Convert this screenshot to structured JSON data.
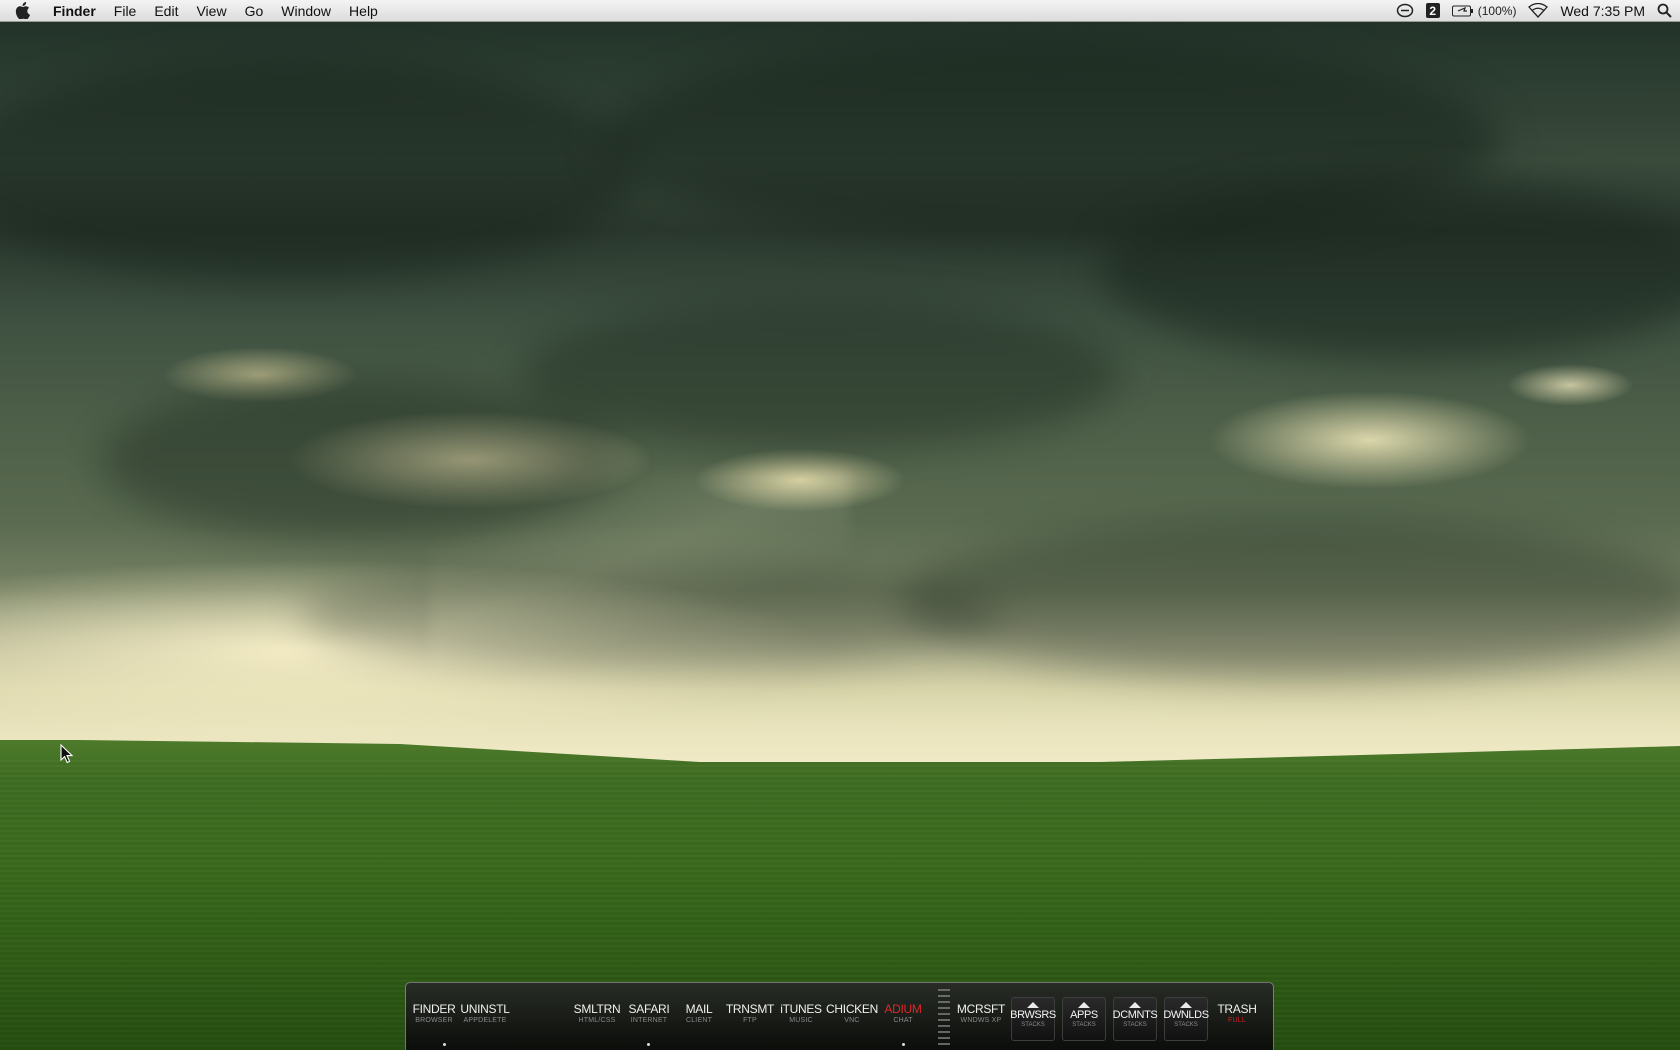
{
  "menubar": {
    "apple_icon": "apple-logo-icon",
    "app_name": "Finder",
    "menus": [
      "File",
      "Edit",
      "View",
      "Go",
      "Window",
      "Help"
    ],
    "status": {
      "chat_icon": "chat-bubble-icon",
      "spaces_number": "2",
      "battery_icon": "battery-icon",
      "battery_percent": "(100%)",
      "wifi_icon": "wifi-icon",
      "clock": "Wed 7:35 PM",
      "spotlight_icon": "spotlight-search-icon"
    }
  },
  "dock": {
    "apps": [
      {
        "label": "FINDER",
        "sub": "BROWSER",
        "running": true
      },
      {
        "label": "UNINSTL",
        "sub": "APPDELETE",
        "running": false
      },
      {
        "label": "SMLTRN",
        "sub": "HTML/CSS",
        "running": false
      },
      {
        "label": "SAFARI",
        "sub": "INTERNET",
        "running": true
      },
      {
        "label": "MAIL",
        "sub": "CLIENT",
        "running": false
      },
      {
        "label": "TRNSMT",
        "sub": "FTP",
        "running": false
      },
      {
        "label": "iTUNES",
        "sub": "MUSIC",
        "running": false
      },
      {
        "label": "CHICKEN",
        "sub": "VNC",
        "running": false
      },
      {
        "label": "ADIUM",
        "sub": "CHAT",
        "running": true,
        "highlight_color": "#e0262a"
      }
    ],
    "others": [
      {
        "label": "MCRSFT",
        "sub": "WNDWS XP"
      },
      {
        "label": "BRWSRS",
        "sub": "STACKS"
      },
      {
        "label": "APPS",
        "sub": "STACKS"
      },
      {
        "label": "DCMNTS",
        "sub": "STACKS"
      },
      {
        "label": "DWNLDS",
        "sub": "STACKS"
      },
      {
        "label": "TRASH",
        "sub": "FULL",
        "sub_color": "#d02024"
      }
    ]
  },
  "wallpaper": {
    "description_icon": "stormy-sky-green-field-wallpaper"
  },
  "cursor": {
    "icon": "arrow-cursor-icon"
  }
}
